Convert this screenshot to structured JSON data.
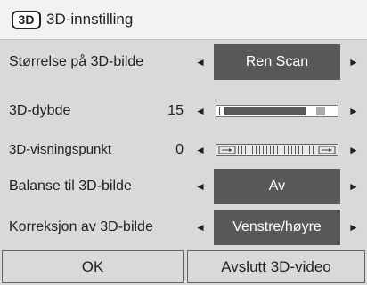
{
  "header": {
    "title": "3D-innstilling",
    "logo": "3D"
  },
  "rows": [
    {
      "label": "Størrelse på 3D-bilde",
      "value": "Ren Scan"
    },
    {
      "label": "3D-dybde",
      "number": "15"
    },
    {
      "label": "3D-visningspunkt",
      "number": "0"
    },
    {
      "label": "Balanse til 3D-bilde",
      "value": "Av"
    },
    {
      "label": "Korreksjon av 3D-bilde",
      "value": "Venstre/høyre"
    }
  ],
  "arrows": {
    "left": "◄",
    "right": "►"
  },
  "buttons": {
    "ok": "OK",
    "exit": "Avslutt 3D-video"
  }
}
